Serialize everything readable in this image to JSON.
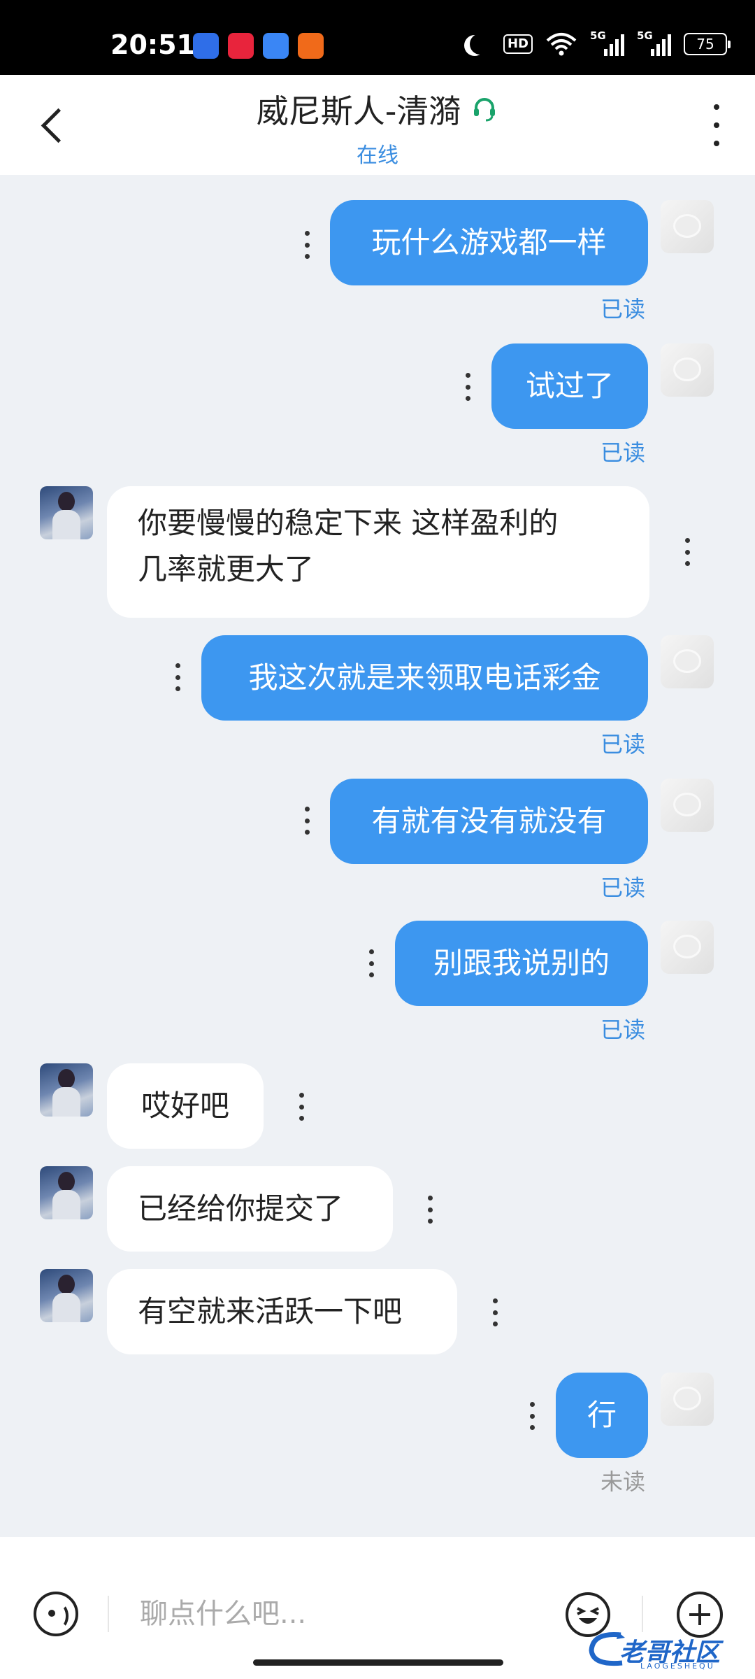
{
  "status_bar": {
    "time": "20:51",
    "network1": "5G",
    "network2": "5G",
    "hd_label": "HD",
    "battery": "75"
  },
  "header": {
    "title": "威尼斯人-清漪",
    "status": "在线"
  },
  "messages": [
    {
      "side": "out",
      "text": "玩什么游戏都一样",
      "receipt": "已读"
    },
    {
      "side": "out",
      "text": "试过了",
      "receipt": "已读"
    },
    {
      "side": "in",
      "text_line1": "你要慢慢的稳定下来 这样盈利的",
      "text_line2": "几率就更大了"
    },
    {
      "side": "out",
      "text": "我这次就是来领取电话彩金",
      "receipt": "已读"
    },
    {
      "side": "out",
      "text": "有就有没有就没有",
      "receipt": "已读"
    },
    {
      "side": "out",
      "text": "别跟我说别的",
      "receipt": "已读"
    },
    {
      "side": "in",
      "text": "哎好吧"
    },
    {
      "side": "in",
      "text": "已经给你提交了"
    },
    {
      "side": "in",
      "text": "有空就来活跃一下吧"
    },
    {
      "side": "out",
      "text": "行",
      "receipt": "未读"
    }
  ],
  "input": {
    "placeholder": "聊点什么吧..."
  },
  "watermark": {
    "text": "老哥社区",
    "sub": "LAOGESHEQU"
  },
  "colors": {
    "outgoing_bubble": "#3d97f0",
    "read_receipt": "#3a8de0",
    "online_status": "#3a8de0",
    "headset_icon": "#1aa36b"
  }
}
